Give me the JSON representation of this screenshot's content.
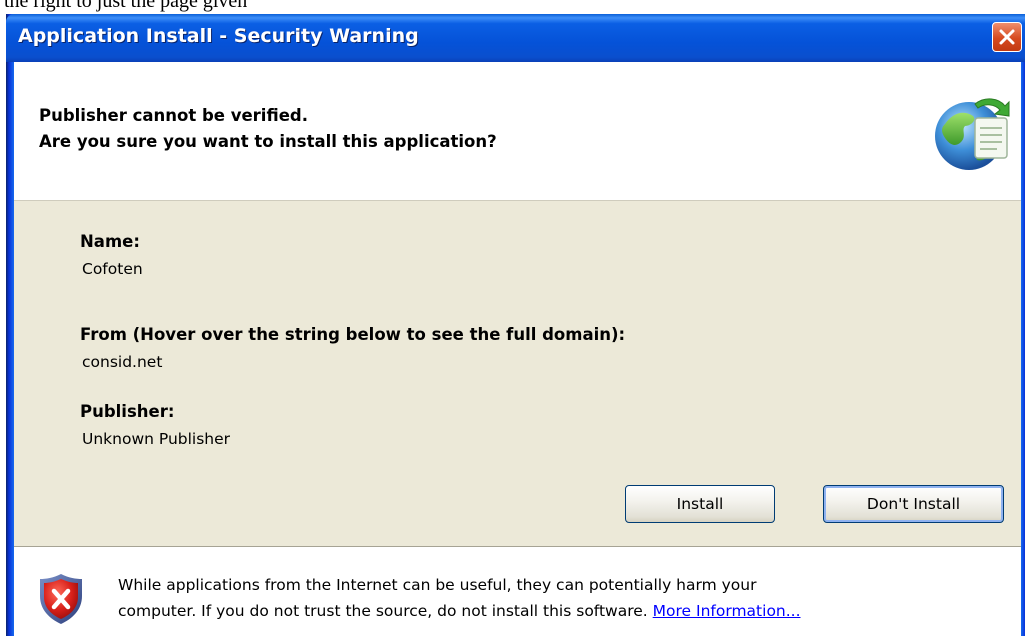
{
  "page_caption": "the right to just the page given",
  "window": {
    "title": "Application Install - Security Warning"
  },
  "header": {
    "line1": "Publisher cannot be verified.",
    "line2": "Are you sure you want to install this application?",
    "icon": "globe-install-icon"
  },
  "details": {
    "name_label": "Name:",
    "name_value": "Cofoten",
    "from_label": "From (Hover over the string below to see the full domain):",
    "from_value": "consid.net",
    "publisher_label": "Publisher:",
    "publisher_value": "Unknown Publisher"
  },
  "buttons": {
    "install": "Install",
    "dont_install": "Don't Install"
  },
  "footer": {
    "icon": "shield-warning-icon",
    "line1": "While applications from the Internet can be useful, they can potentially harm your",
    "line2": "computer. If you do not trust the source, do not install this software.",
    "link": "More Information..."
  },
  "colors": {
    "titlebar": "#0552d8",
    "dialog_body": "#ece9d8",
    "close_button": "#d64a1f",
    "link": "#0000ff"
  }
}
